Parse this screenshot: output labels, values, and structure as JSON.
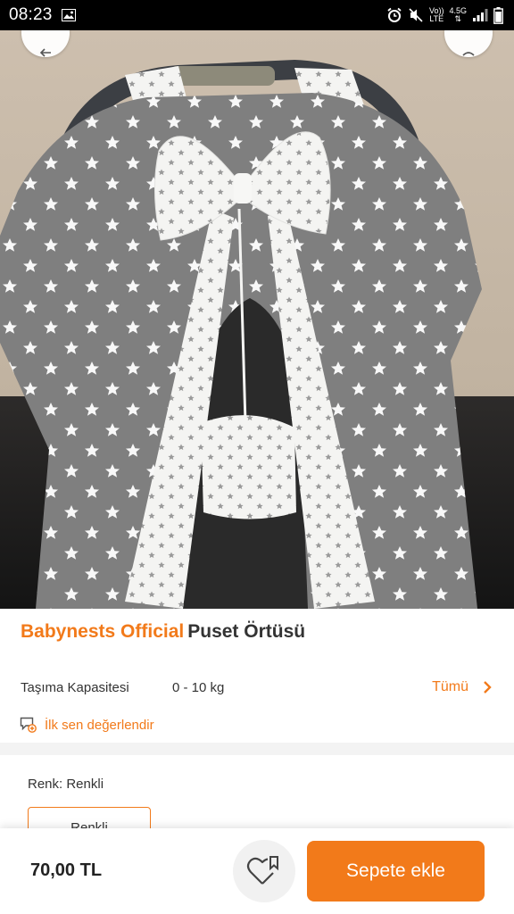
{
  "status_bar": {
    "time": "08:23",
    "network_vo": "Vo))",
    "network_lte": "LTE",
    "network_gen": "4.5G",
    "icons": [
      "image-icon",
      "alarm-icon",
      "mute-icon",
      "signal-icon",
      "battery-icon"
    ]
  },
  "product": {
    "brand": "Babynests Official",
    "name": "Puset Örtüsü",
    "spec_label": "Taşıma Kapasitesi",
    "spec_value": "0 - 10 kg",
    "spec_link": "Tümü",
    "rate_text": "İlk sen değerlendir"
  },
  "variant": {
    "label": "Renk: Renkli",
    "selected": "Renkli"
  },
  "bottom_bar": {
    "price": "70,00 TL",
    "cart_button": "Sepete ekle"
  },
  "colors": {
    "accent": "#f27a1a",
    "fabric_gray": "#7d7d7d",
    "text": "#333333"
  }
}
